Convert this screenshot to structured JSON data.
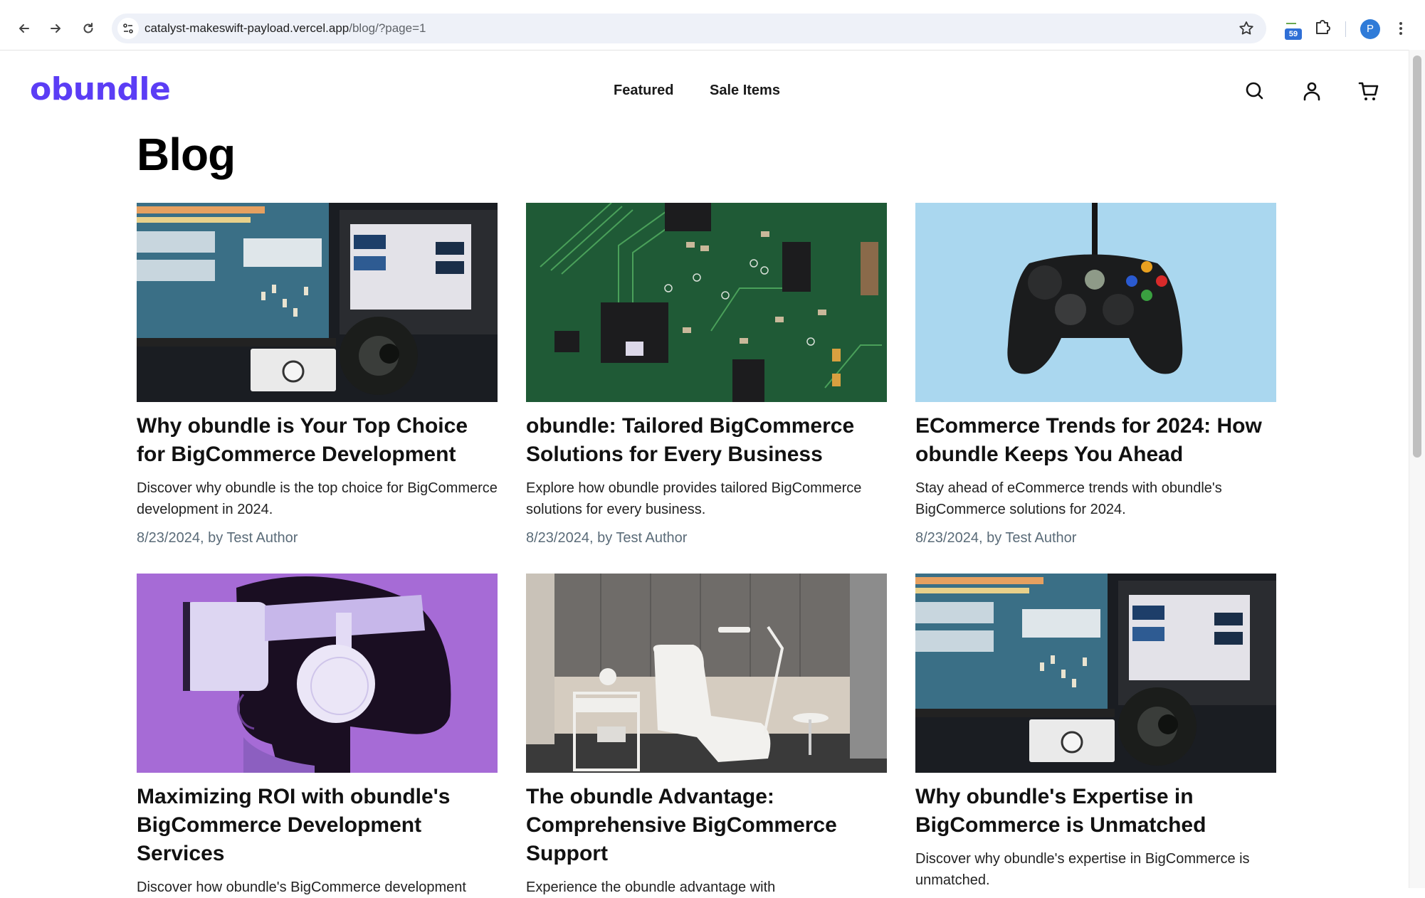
{
  "browser": {
    "url_host": "catalyst-makeswift-payload.vercel.app",
    "url_path": "/blog/?page=1",
    "extension_badge": "59",
    "profile_initial": "P"
  },
  "site": {
    "logo": "obundle",
    "brand_color": "#5b3df5",
    "nav": [
      {
        "label": "Featured"
      },
      {
        "label": "Sale Items"
      }
    ],
    "icons": [
      "search-icon",
      "account-icon",
      "cart-icon"
    ]
  },
  "page": {
    "title": "Blog"
  },
  "posts": [
    {
      "title": "Why obundle is Your Top Choice for BigCommerce Development",
      "excerpt": "Discover why obundle is the top choice for BigCommerce development in 2024.",
      "meta": "8/23/2024, by Test Author",
      "image": "audio-studio-monitors-headphones"
    },
    {
      "title": "obundle: Tailored BigCommerce Solutions for Every Business",
      "excerpt": "Explore how obundle provides tailored BigCommerce solutions for every business.",
      "meta": "8/23/2024, by Test Author",
      "image": "green-circuit-board"
    },
    {
      "title": "ECommerce Trends for 2024: How obundle Keeps You Ahead",
      "excerpt": "Stay ahead of eCommerce trends with obundle's BigCommerce solutions for 2024.",
      "meta": "8/23/2024, by Test Author",
      "image": "game-controller-on-blue"
    },
    {
      "title": "Maximizing ROI with obundle's BigCommerce Development Services",
      "excerpt": "Discover how obundle's BigCommerce development",
      "meta": "",
      "image": "person-vr-headset-purple"
    },
    {
      "title": "The obundle Advantage: Comprehensive BigCommerce Support",
      "excerpt": "Experience the obundle advantage with",
      "meta": "",
      "image": "white-treatment-chair-room"
    },
    {
      "title": "Why obundle's Expertise in BigCommerce is Unmatched",
      "excerpt": "Discover why obundle's expertise in BigCommerce is unmatched.",
      "meta": "",
      "image": "audio-studio-monitors-headphones"
    }
  ]
}
